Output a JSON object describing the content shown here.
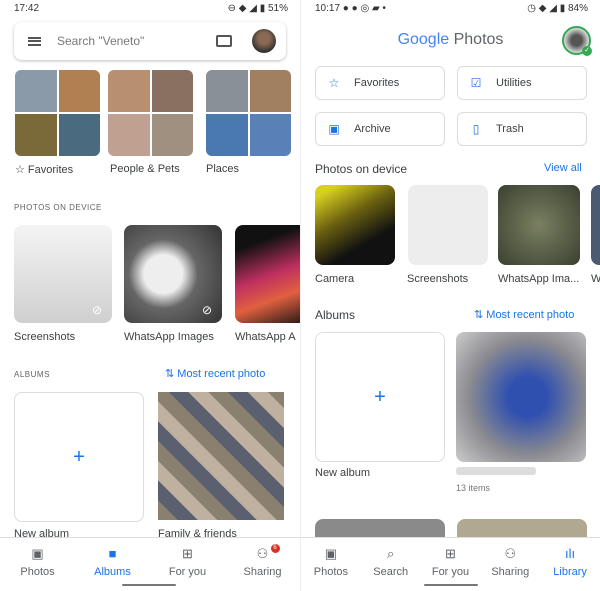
{
  "left": {
    "status": {
      "time": "17:42",
      "battery": "51%",
      "icons": [
        "dnd-icon",
        "wifi-icon",
        "signal-icon",
        "battery-icon"
      ]
    },
    "search": {
      "placeholder": "Search \"Veneto\""
    },
    "top_albums": [
      {
        "label": "Favorites",
        "icon": "star-icon"
      },
      {
        "label": "People & Pets"
      },
      {
        "label": "Places"
      }
    ],
    "photos_on_device": {
      "title": "PHOTOS ON DEVICE",
      "items": [
        {
          "label": "Screenshots"
        },
        {
          "label": "WhatsApp Images"
        },
        {
          "label": "WhatsApp A"
        }
      ]
    },
    "albums": {
      "title": "ALBUMS",
      "sort_label": "Most recent photo",
      "items": [
        {
          "label": "New album"
        },
        {
          "label": "Family & friends"
        }
      ]
    },
    "nav": {
      "items": [
        {
          "label": "Photos",
          "icon": "photo-icon"
        },
        {
          "label": "Albums",
          "icon": "albums-icon",
          "active": true
        },
        {
          "label": "For you",
          "icon": "for-you-icon"
        },
        {
          "label": "Sharing",
          "icon": "sharing-icon",
          "badge": "6"
        }
      ]
    }
  },
  "right": {
    "status": {
      "time": "10:17",
      "battery": "84%",
      "icons": [
        "telegram-icon",
        "telegram-icon",
        "whatsapp-icon",
        "game-icon",
        "alarm-icon",
        "wifi-icon",
        "signal-icon",
        "battery-icon"
      ]
    },
    "logo": {
      "google": "Google",
      "photos": "Photos"
    },
    "buttons": [
      {
        "label": "Favorites",
        "icon": "star-icon"
      },
      {
        "label": "Utilities",
        "icon": "utilities-icon"
      },
      {
        "label": "Archive",
        "icon": "archive-icon"
      },
      {
        "label": "Trash",
        "icon": "trash-icon"
      }
    ],
    "photos_on_device": {
      "title": "Photos on device",
      "view_all": "View all",
      "items": [
        {
          "label": "Camera"
        },
        {
          "label": "Screenshots"
        },
        {
          "label": "WhatsApp Ima..."
        },
        {
          "label": "W"
        }
      ]
    },
    "albums": {
      "title": "Albums",
      "sort_label": "Most recent photo",
      "items": [
        {
          "label": "New album"
        },
        {
          "label": "",
          "count": "13 items"
        }
      ]
    },
    "nav": {
      "items": [
        {
          "label": "Photos",
          "icon": "photo-icon"
        },
        {
          "label": "Search",
          "icon": "search-icon"
        },
        {
          "label": "For you",
          "icon": "for-you-icon"
        },
        {
          "label": "Sharing",
          "icon": "sharing-icon"
        },
        {
          "label": "Library",
          "icon": "library-icon",
          "active": true
        }
      ]
    }
  },
  "colors": {
    "accent": "#1a73e8",
    "badge": "#d93025"
  }
}
